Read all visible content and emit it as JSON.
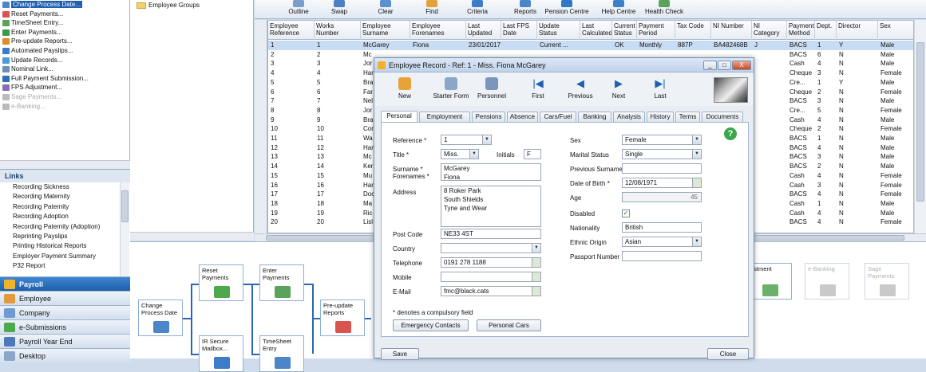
{
  "tree_top": [
    {
      "label": "Change Process Date...",
      "selected": true,
      "disabled": false
    },
    {
      "label": "Reset Payments...",
      "selected": false,
      "disabled": false
    },
    {
      "label": "TimeSheet Entry...",
      "selected": false,
      "disabled": false
    },
    {
      "label": "Enter Payments...",
      "selected": false,
      "disabled": false
    },
    {
      "label": "Pre-update Reports...",
      "selected": false,
      "disabled": false
    },
    {
      "label": "Automated Payslips...",
      "selected": false,
      "disabled": false
    },
    {
      "label": "Update Records...",
      "selected": false,
      "disabled": false
    },
    {
      "label": "Nominal Link...",
      "selected": false,
      "disabled": false
    },
    {
      "label": "Full Payment Submission...",
      "selected": false,
      "disabled": false
    },
    {
      "label": "FPS Adjustment...",
      "selected": false,
      "disabled": false
    },
    {
      "label": "Sage Payments...",
      "selected": false,
      "disabled": true
    },
    {
      "label": "e-Banking...",
      "selected": false,
      "disabled": true
    }
  ],
  "links": {
    "heading": "Links",
    "items": [
      "Recording Sickness",
      "Recording Maternity",
      "Recording Paternity",
      "Recording Adoption",
      "Recording Paternity (Adoption)",
      "Reprinting Payslips",
      "Printing Historical Reports",
      "Employer Payment Summary",
      "P32 Report"
    ]
  },
  "nav": [
    {
      "label": "Payroll",
      "active": true
    },
    {
      "label": "Employee",
      "active": false
    },
    {
      "label": "Company",
      "active": false
    },
    {
      "label": "e-Submissions",
      "active": false
    },
    {
      "label": "Payroll Year End",
      "active": false
    },
    {
      "label": "Desktop",
      "active": false
    }
  ],
  "folder_tree": {
    "item": "Employee Groups"
  },
  "toolbar": [
    "Outline",
    "Swap",
    "Clear",
    "Find",
    "Criteria",
    "Reports",
    "Pension Centre",
    "Help Centre",
    "Health Check"
  ],
  "grid": {
    "headers": [
      "Employee Reference",
      "Works Number",
      "Employee Surname",
      "Employee Forenames",
      "Last Updated",
      "Last FPS Date",
      "Update Status",
      "Last Calculated",
      "Current Status",
      "Payment Period",
      "Tax Code",
      "NI Number",
      "NI Category",
      "Payment Method",
      "Dept.",
      "Director",
      "Sex"
    ],
    "rows": [
      [
        "1",
        "1",
        "McGarey",
        "Fiona",
        "23/01/2017",
        "",
        "Current ...",
        "",
        "OK",
        "Monthly",
        "887P",
        "BA482468B",
        "J",
        "BACS",
        "1",
        "Y",
        "Male"
      ],
      [
        "2",
        "2",
        "Mc",
        "",
        "",
        "",
        "",
        "",
        "",
        "",
        "",
        "",
        "",
        "BACS",
        "6",
        "N",
        "Male"
      ],
      [
        "3",
        "3",
        "Jor",
        "",
        "",
        "",
        "",
        "",
        "",
        "",
        "",
        "",
        "",
        "Cash",
        "4",
        "N",
        "Male"
      ],
      [
        "4",
        "4",
        "Har",
        "",
        "",
        "",
        "",
        "",
        "",
        "",
        "",
        "",
        "",
        "Cheque",
        "3",
        "N",
        "Female"
      ],
      [
        "5",
        "5",
        "Bra",
        "",
        "",
        "",
        "",
        "",
        "",
        "",
        "",
        "",
        "",
        "Cre...",
        "1",
        "Y",
        "Male"
      ],
      [
        "6",
        "6",
        "Far",
        "",
        "",
        "",
        "",
        "",
        "",
        "",
        "",
        "",
        "",
        "Cheque",
        "2",
        "N",
        "Female"
      ],
      [
        "7",
        "7",
        "Nel",
        "",
        "",
        "",
        "",
        "",
        "",
        "",
        "",
        "",
        "",
        "BACS",
        "3",
        "N",
        "Male"
      ],
      [
        "8",
        "8",
        "Jor",
        "",
        "",
        "",
        "",
        "",
        "",
        "",
        "",
        "",
        "",
        "Cre...",
        "5",
        "N",
        "Female"
      ],
      [
        "9",
        "9",
        "Bra",
        "",
        "",
        "",
        "",
        "",
        "",
        "",
        "",
        "",
        "",
        "Cash",
        "4",
        "N",
        "Male"
      ],
      [
        "10",
        "10",
        "Cor",
        "",
        "",
        "",
        "",
        "",
        "",
        "",
        "",
        "",
        "",
        "Cheque",
        "2",
        "N",
        "Female"
      ],
      [
        "11",
        "11",
        "Wa",
        "",
        "",
        "",
        "",
        "",
        "",
        "",
        "",
        "",
        "",
        "BACS",
        "1",
        "N",
        "Male"
      ],
      [
        "12",
        "12",
        "Har",
        "",
        "",
        "",
        "",
        "",
        "",
        "",
        "",
        "",
        "",
        "BACS",
        "4",
        "N",
        "Male"
      ],
      [
        "13",
        "13",
        "Mc",
        "",
        "",
        "",
        "",
        "",
        "",
        "",
        "",
        "",
        "",
        "BACS",
        "3",
        "N",
        "Male"
      ],
      [
        "14",
        "14",
        "Ker",
        "",
        "",
        "",
        "",
        "",
        "",
        "",
        "",
        "",
        "",
        "BACS",
        "2",
        "N",
        "Male"
      ],
      [
        "15",
        "15",
        "Mu",
        "",
        "",
        "",
        "",
        "",
        "",
        "",
        "",
        "",
        "",
        "Cash",
        "4",
        "N",
        "Female"
      ],
      [
        "16",
        "16",
        "Har",
        "",
        "",
        "",
        "",
        "",
        "",
        "",
        "",
        "",
        "",
        "Cash",
        "3",
        "N",
        "Female"
      ],
      [
        "17",
        "17",
        "Doc",
        "",
        "",
        "",
        "",
        "",
        "",
        "",
        "",
        "",
        "",
        "BACS",
        "4",
        "N",
        "Female"
      ],
      [
        "18",
        "18",
        "Ma",
        "",
        "",
        "",
        "",
        "",
        "",
        "",
        "",
        "",
        "",
        "Cash",
        "1",
        "N",
        "Male"
      ],
      [
        "19",
        "19",
        "Ric",
        "",
        "",
        "",
        "",
        "",
        "",
        "",
        "",
        "",
        "",
        "Cash",
        "4",
        "N",
        "Male"
      ],
      [
        "20",
        "20",
        "Lisl",
        "",
        "",
        "",
        "",
        "",
        "",
        "",
        "",
        "",
        "",
        "BACS",
        "4",
        "N",
        "Female"
      ]
    ]
  },
  "workflow": [
    {
      "label": "Change Process Date",
      "disabled": false
    },
    {
      "label": "Reset Payments",
      "disabled": false
    },
    {
      "label": "IR Secure Mailbox...",
      "disabled": false
    },
    {
      "label": "Enter Payments",
      "disabled": false
    },
    {
      "label": "TimeSheet Entry",
      "disabled": false
    },
    {
      "label": "Pre-update Reports",
      "disabled": false
    },
    {
      "label": "ustment",
      "disabled": false
    },
    {
      "label": "e-Banking",
      "disabled": true
    },
    {
      "label": "Sage Payments",
      "disabled": true
    }
  ],
  "dialog": {
    "title": "Employee Record - Ref: 1 - Miss. Fiona McGarey",
    "toolbar": [
      "New",
      "Starter Form",
      "Personnel",
      "First",
      "Previous",
      "Next",
      "Last"
    ],
    "tabs": [
      "Personal",
      "Employment",
      "Pensions",
      "Absence",
      "Cars/Fuel",
      "Banking",
      "Analysis",
      "History",
      "Terms",
      "Documents"
    ],
    "fields": {
      "reference_label": "Reference *",
      "reference": "1",
      "title_label": "Title *",
      "title": "Miss.",
      "initials_label": "Initials",
      "initials": "F",
      "surname_label": "Surname *",
      "surname": "McGarey",
      "forenames_label": "Forenames *",
      "forenames": "Fiona",
      "address_label": "Address",
      "address1": "8 Roker Park",
      "address2": "South Shields",
      "address3": "Tyne and Wear",
      "postcode_label": "Post Code",
      "postcode": "NE33 4ST",
      "country_label": "Country",
      "country": "",
      "telephone_label": "Telephone",
      "telephone": "0191 278 1188",
      "mobile_label": "Mobile",
      "mobile": "",
      "email_label": "E-Mail",
      "email": "fmc@black.cats",
      "compulsory_note": "* denotes a compulsory field",
      "sex_label": "Sex",
      "sex": "Female",
      "marital_label": "Marital Status",
      "marital": "Single",
      "prev_surname_label": "Previous Surname",
      "prev_surname": "",
      "dob_label": "Date of Birth *",
      "dob": "12/08/1971",
      "age_label": "Age",
      "age": "45",
      "disabled_label": "Disabled",
      "nationality_label": "Nationality",
      "nationality": "British",
      "ethnic_label": "Ethnic Origin",
      "ethnic": "Asian",
      "passport_label": "Passport Number",
      "passport": ""
    },
    "emergency_btn": "Emergency Contacts",
    "personal_cars_btn": "Personal Cars",
    "save_btn": "Save",
    "close_btn": "Close",
    "help": "?",
    "win_min": "_",
    "win_max": "□",
    "win_close": "X"
  },
  "colors": {
    "accent": "#1f5fb0",
    "selected_row": "#c8dcf3"
  }
}
